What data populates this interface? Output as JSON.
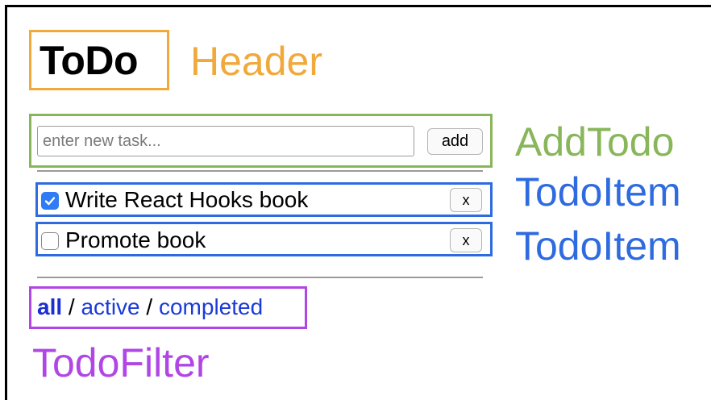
{
  "header": {
    "title": "ToDo",
    "component_label": "Header"
  },
  "add_todo": {
    "input_placeholder": "enter new task...",
    "input_value": "",
    "add_button_label": "add",
    "component_label": "AddTodo"
  },
  "todo_items": {
    "component_label": "TodoItem",
    "items": [
      {
        "title": "Write React Hooks book",
        "completed": true,
        "remove_label": "x"
      },
      {
        "title": "Promote book",
        "completed": false,
        "remove_label": "x"
      }
    ]
  },
  "filter": {
    "options": [
      "all",
      "active",
      "completed"
    ],
    "selected": "all",
    "separator": "/",
    "component_label": "TodoFilter"
  },
  "colors": {
    "header_accent": "#f0a93a",
    "addtodo_accent": "#89b65a",
    "todoitem_accent": "#2f6be0",
    "todofilter_accent": "#b146e6",
    "checkbox_checked": "#2f7cf6",
    "link": "#1a3bd8"
  },
  "icons": {
    "checkbox_checked": "checkmark-icon"
  }
}
